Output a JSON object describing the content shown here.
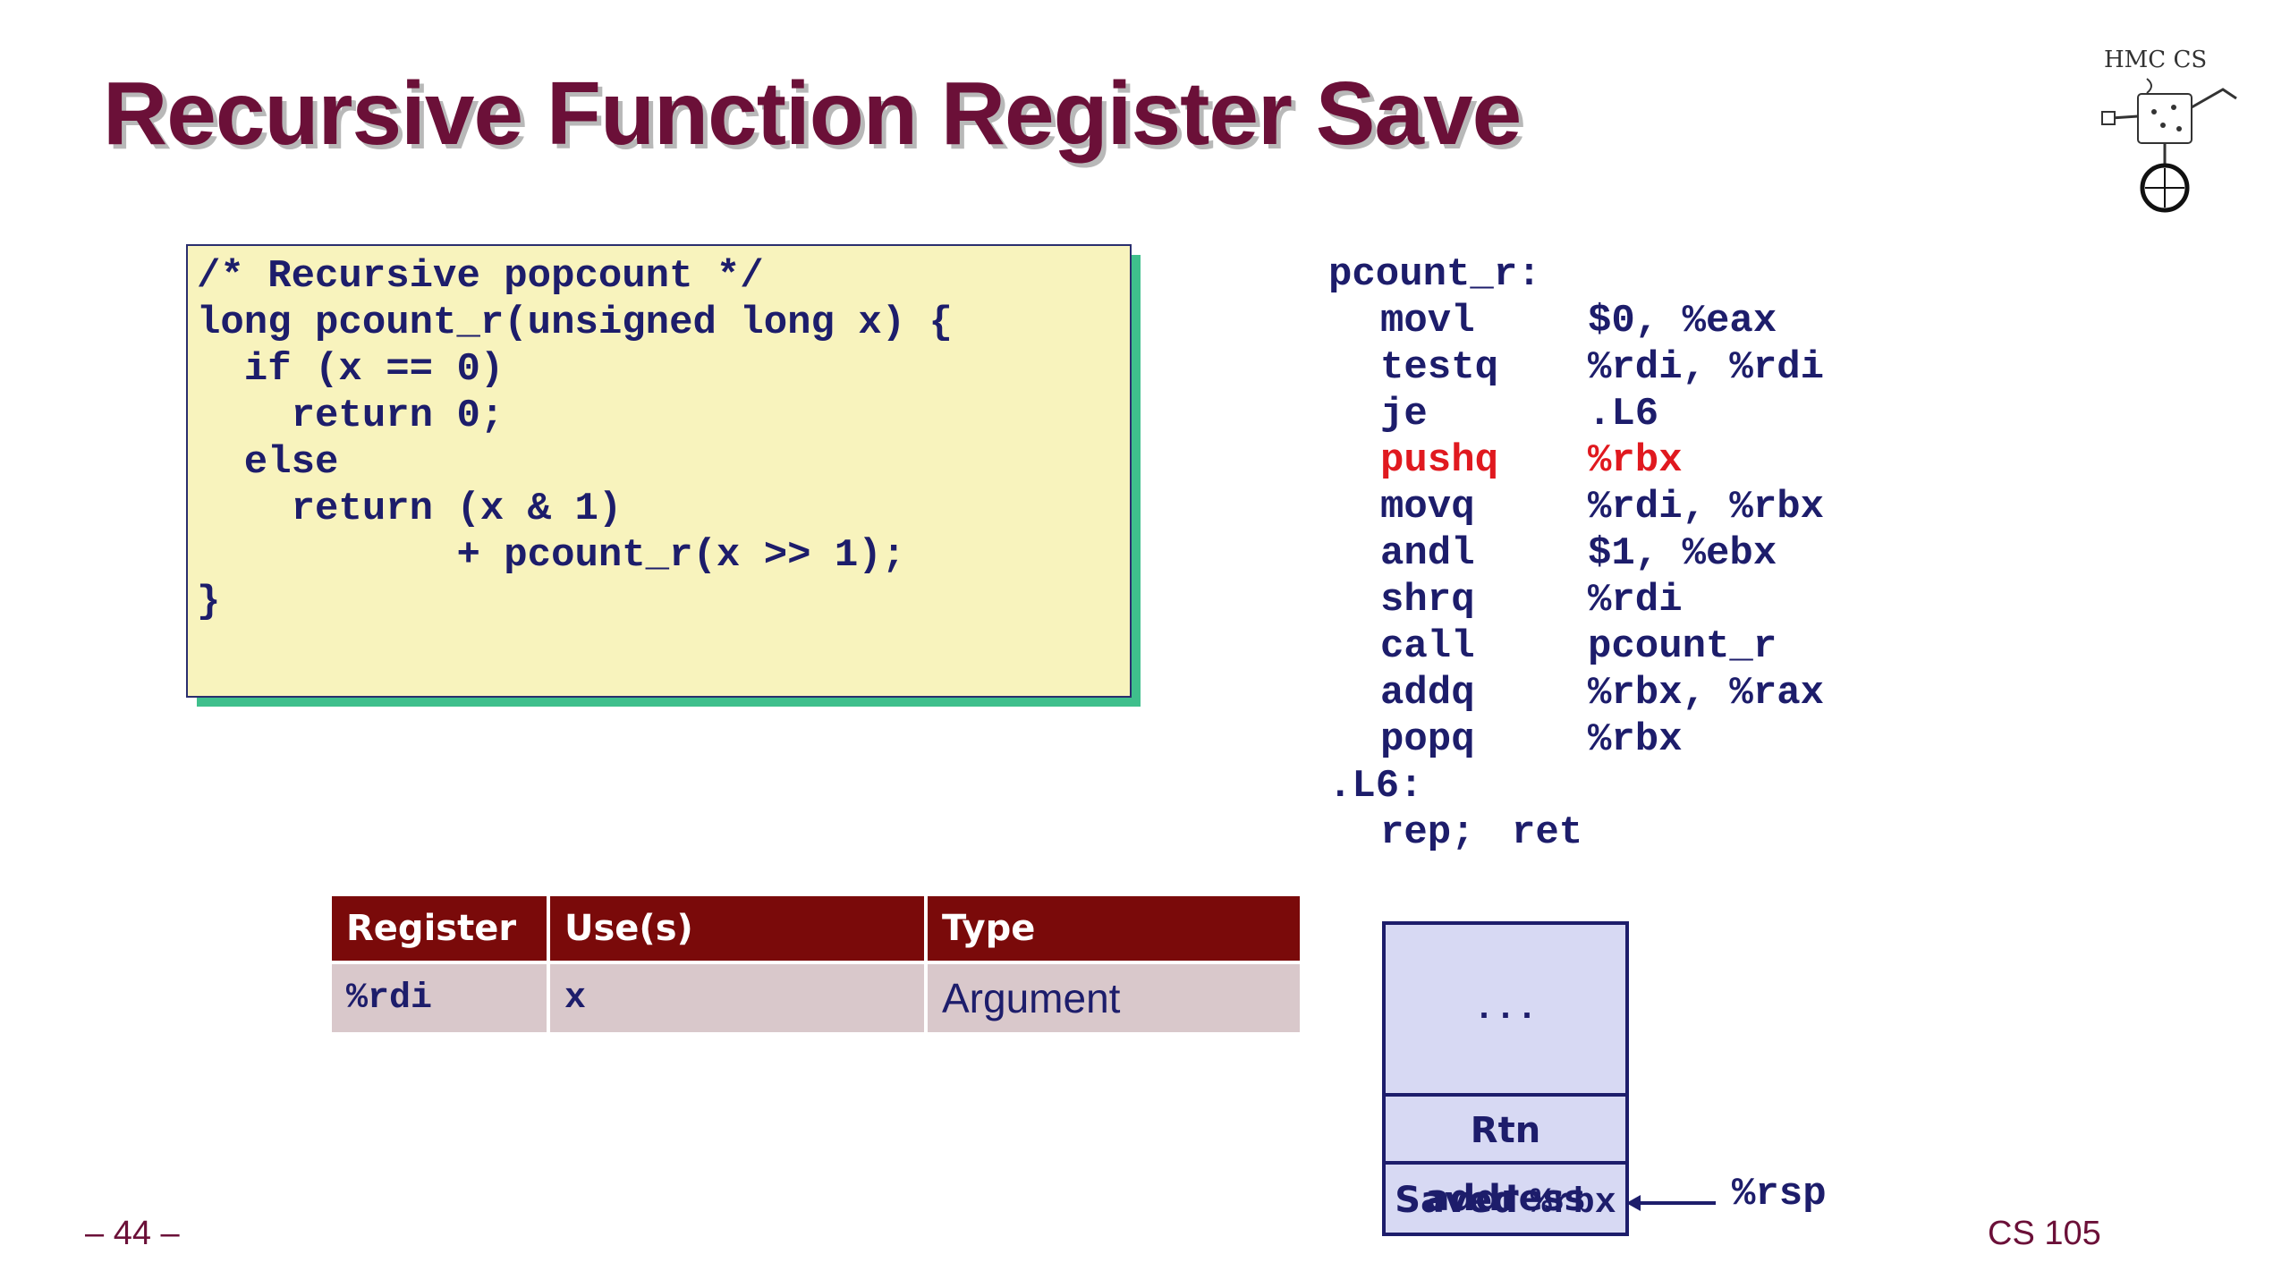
{
  "slide": {
    "title": "Recursive Function Register Save",
    "page_number": "– 44 –",
    "course": "CS 105",
    "logo_text": "HMC CS"
  },
  "c_code": {
    "lines": [
      "/* Recursive popcount */",
      "long pcount_r(unsigned long x) {",
      "  if (x == 0)",
      "    return 0;",
      "  else",
      "    return (x & 1)",
      "           + pcount_r(x >> 1);",
      "}"
    ]
  },
  "assembly": {
    "label_pcount": "pcount_r:",
    "label_l6": ".L6:",
    "instructions": [
      {
        "op": "movl",
        "args": "$0, %eax"
      },
      {
        "op": "testq",
        "args": "%rdi, %rdi"
      },
      {
        "op": "je",
        "args": ".L6"
      },
      {
        "op": "pushq",
        "args": "%rbx",
        "highlight": "#e0191f"
      },
      {
        "op": "movq",
        "args": "%rdi, %rbx"
      },
      {
        "op": "andl",
        "args": "$1, %ebx"
      },
      {
        "op": "shrq",
        "args": "%rdi"
      },
      {
        "op": "call",
        "args": "pcount_r"
      },
      {
        "op": "addq",
        "args": "%rbx, %rax"
      },
      {
        "op": "popq",
        "args": "%rbx"
      }
    ],
    "final": {
      "op": "rep;",
      "args": "ret"
    }
  },
  "register_table": {
    "headers": [
      "Register",
      "Use(s)",
      "Type"
    ],
    "rows": [
      {
        "register": "%rdi",
        "use": "x",
        "type": "Argument"
      }
    ]
  },
  "stack": {
    "dots": "...",
    "rtn": "Rtn address",
    "saved_label": "Saved",
    "saved_reg": "%rbx",
    "pointer": "%rsp"
  },
  "colors": {
    "title": "#6b1038",
    "code_bg": "#f8f3bd",
    "code_shadow": "#3fbf8c",
    "text": "#1d1d6b",
    "highlight": "#e0191f",
    "table_header": "#7a0a0a",
    "table_row": "#d9c8cb",
    "stack_bg": "#d7d9f3"
  }
}
